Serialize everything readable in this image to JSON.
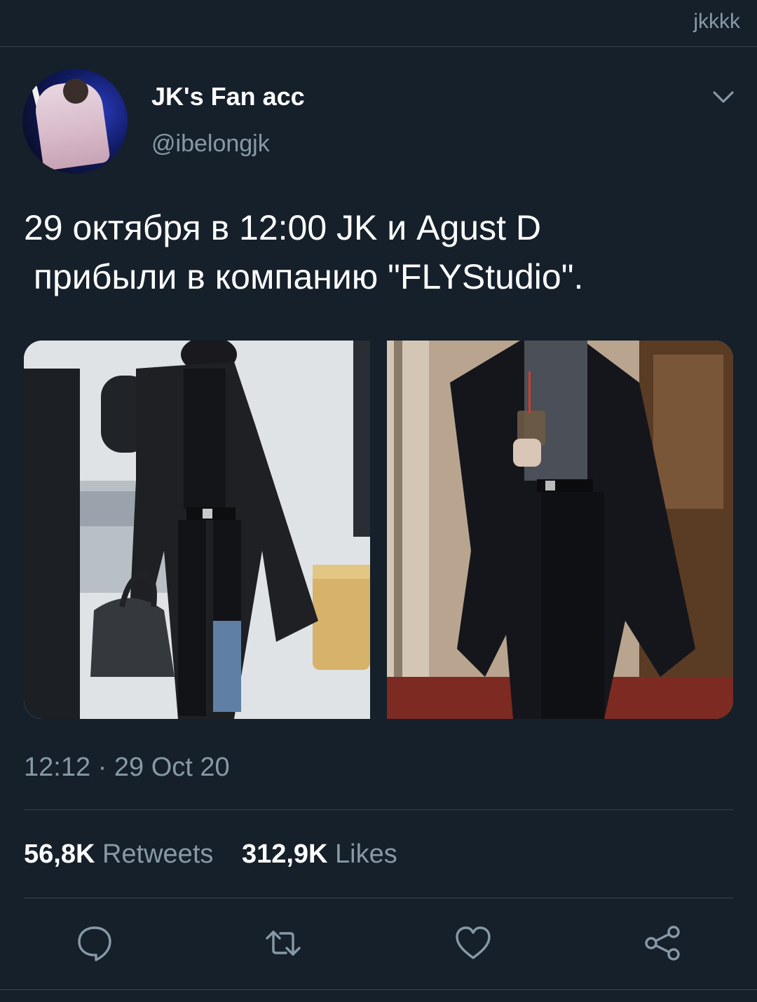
{
  "header": {
    "label": "jkkkk"
  },
  "author": {
    "display_name": "JK's Fan acc",
    "handle": "@ibelongjk"
  },
  "tweet": {
    "text": "29 октября в 12:00 JK и Agust D\n прибыли в компанию \"FLYStudio\".",
    "timestamp": "12:12 · 29 Oct 20"
  },
  "stats": {
    "retweets_count": "56,8K",
    "retweets_label": "Retweets",
    "likes_count": "312,9K",
    "likes_label": "Likes"
  },
  "icons": {
    "menu": "chevron-down-icon",
    "reply": "reply-icon",
    "retweet": "retweet-icon",
    "like": "heart-icon",
    "share": "share-icon"
  },
  "colors": {
    "background": "#15202b",
    "secondary_text": "#8899a6",
    "divider": "#38444d"
  }
}
